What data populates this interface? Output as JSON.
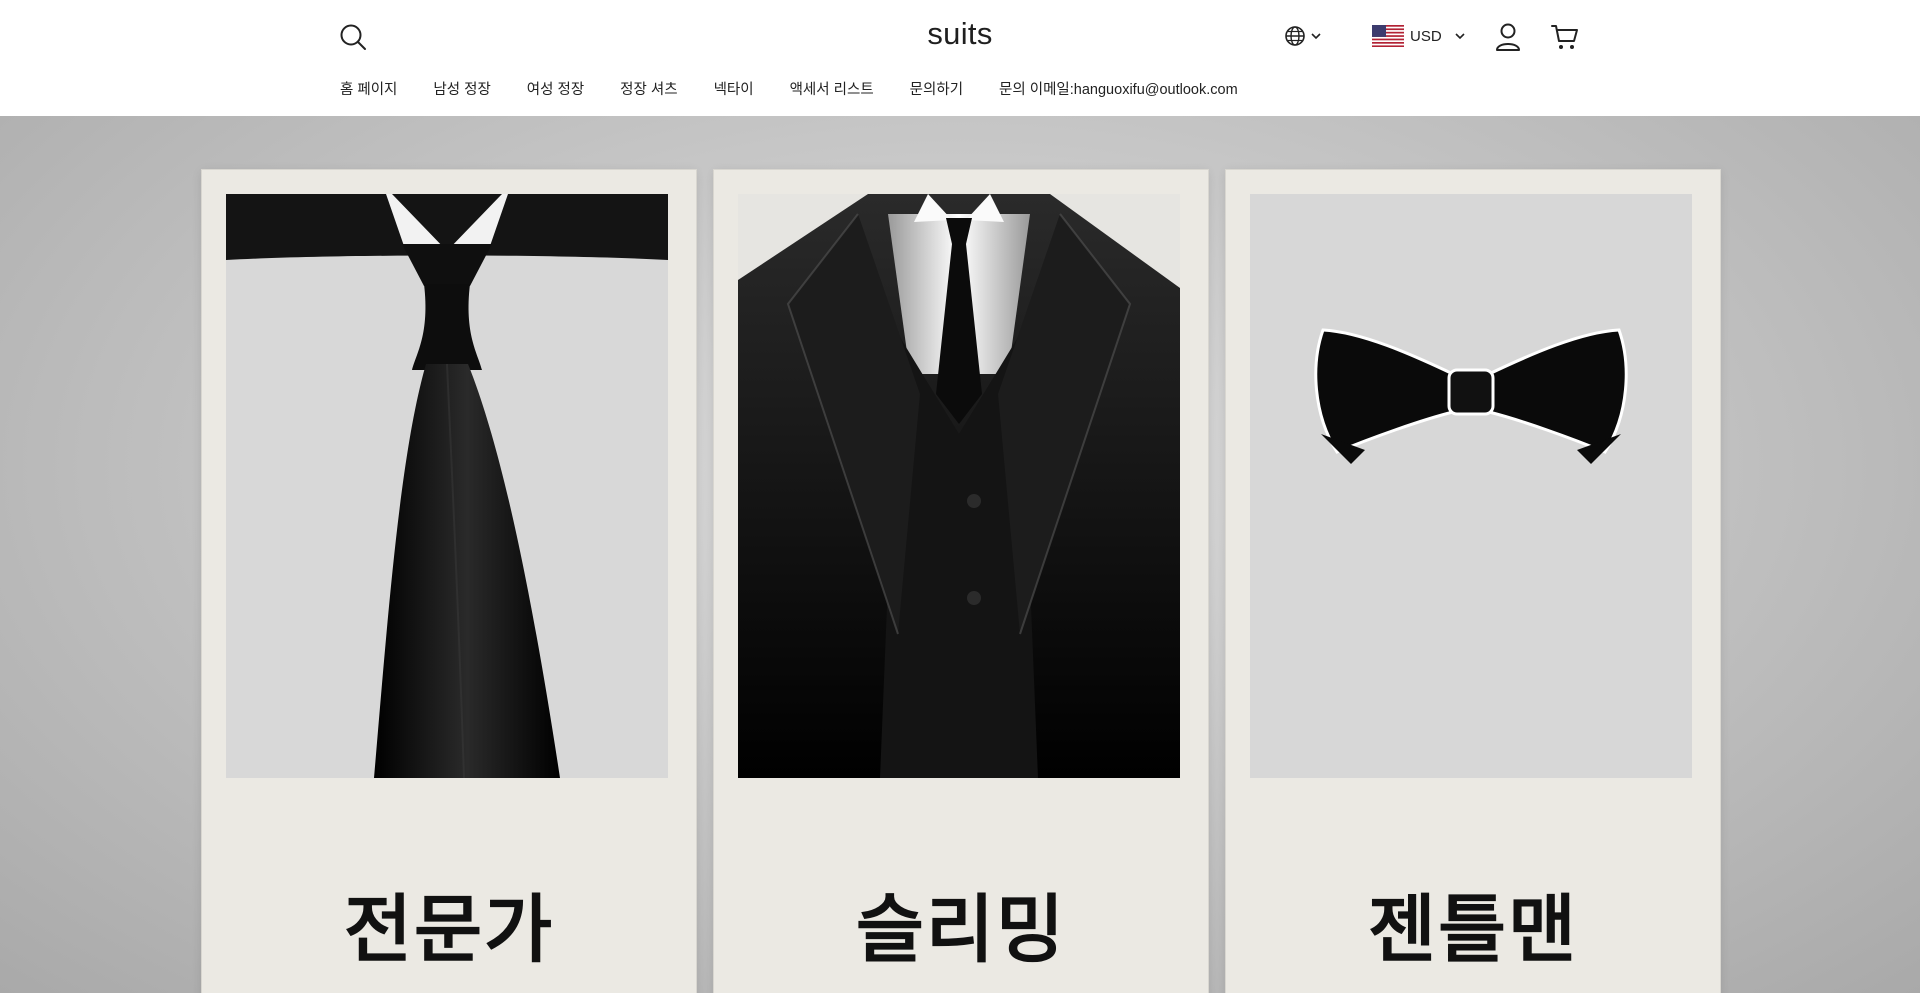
{
  "header": {
    "logo": "suits",
    "currency": "USD"
  },
  "nav": {
    "items": [
      "홈 페이지",
      "남성 정장",
      "여성 정장",
      "정장 셔츠",
      "넥타이",
      "액세서 리스트",
      "문의하기",
      "문의 이메일:hanguoxifu@outlook.com"
    ]
  },
  "cards": [
    {
      "title": "전문가",
      "image": "necktie-illustration",
      "swatches": [
        "#0b0b0b",
        "#6d6d6d"
      ]
    },
    {
      "title": "슬리밍",
      "image": "tuxedo-illustration",
      "swatches": [
        "#0b0b0b",
        "#6d6d6d"
      ]
    },
    {
      "title": "젠틀맨",
      "image": "bowtie-illustration",
      "swatches": [
        "#0b0b0b",
        "#6d6d6d"
      ]
    }
  ],
  "colors": {
    "accent": "#222222",
    "card_bg": "#ebe9e3",
    "hero_bg": "#c6c6c6"
  }
}
